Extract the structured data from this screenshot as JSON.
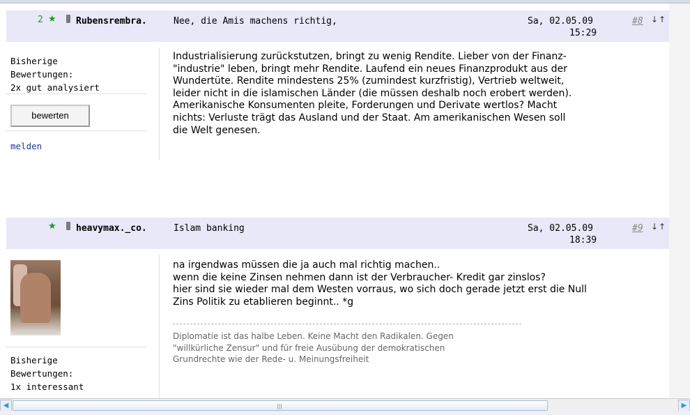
{
  "post1": {
    "rating_count": "2",
    "author": "Rubensrembra.",
    "subject": "Nee, die Amis machens richtig,",
    "date": "Sa, 02.05.09",
    "time": "15:29",
    "number": "#8",
    "arrows": "↓↑",
    "sidebar": {
      "ratings_label_1": "Bisherige",
      "ratings_label_2": "Bewertungen:",
      "rating_value": "2x gut analysiert",
      "rate_button": "bewerten",
      "report_link": "melden"
    },
    "body": "Industrialisierung zurückstutzen, bringt zu wenig Rendite. Lieber von der Finanz-\n\"industrie\" leben, bringt mehr Rendite. Laufend ein neues Finanzprodukt aus der\nWundertüte. Rendite mindestens 25% (zumindest kurzfristig), Vertrieb weltweit,\nleider nicht in die islamischen Länder (die müssen deshalb noch erobert werden).\nAmerikanische Konsumenten pleite, Forderungen und Derivate wertlos? Macht\nnichts: Verluste trägt das Ausland und der Staat. Am amerikanischen Wesen soll\ndie Welt genesen."
  },
  "post2": {
    "author": "heavymax._co.",
    "subject": "Islam banking",
    "date": "Sa, 02.05.09",
    "time": "18:39",
    "number": "#9",
    "arrows": "↓↑",
    "sidebar": {
      "ratings_label_1": "Bisherige",
      "ratings_label_2": "Bewertungen:",
      "rating_value": "1x interessant"
    },
    "body": "na irgendwas müssen die ja auch mal richtig machen..\nwenn die keine Zinsen nehmen dann ist der Verbraucher- Kredit gar zinslos?\nhier sind sie wieder mal dem Westen vorraus, wo sich doch gerade jetzt erst die Null\nZins Politik zu etablieren beginnt.. *g",
    "signature": "Diplomatie ist das halbe Leben. Keine Macht den Radikalen. Gegen\n\"willkürliche  Zensur\" und für freie Ausübung der demokratischen\nGrundrechte wie der Rede- u. Meinungsfreiheit"
  },
  "icons": {
    "star": "★",
    "scroll_left": "◀",
    "scroll_right": "▶",
    "grip": "|||"
  },
  "colors": {
    "header_bg": "#e8e8f8",
    "link_blue": "#1c3d8c",
    "star_green": "#1a9a1a"
  }
}
